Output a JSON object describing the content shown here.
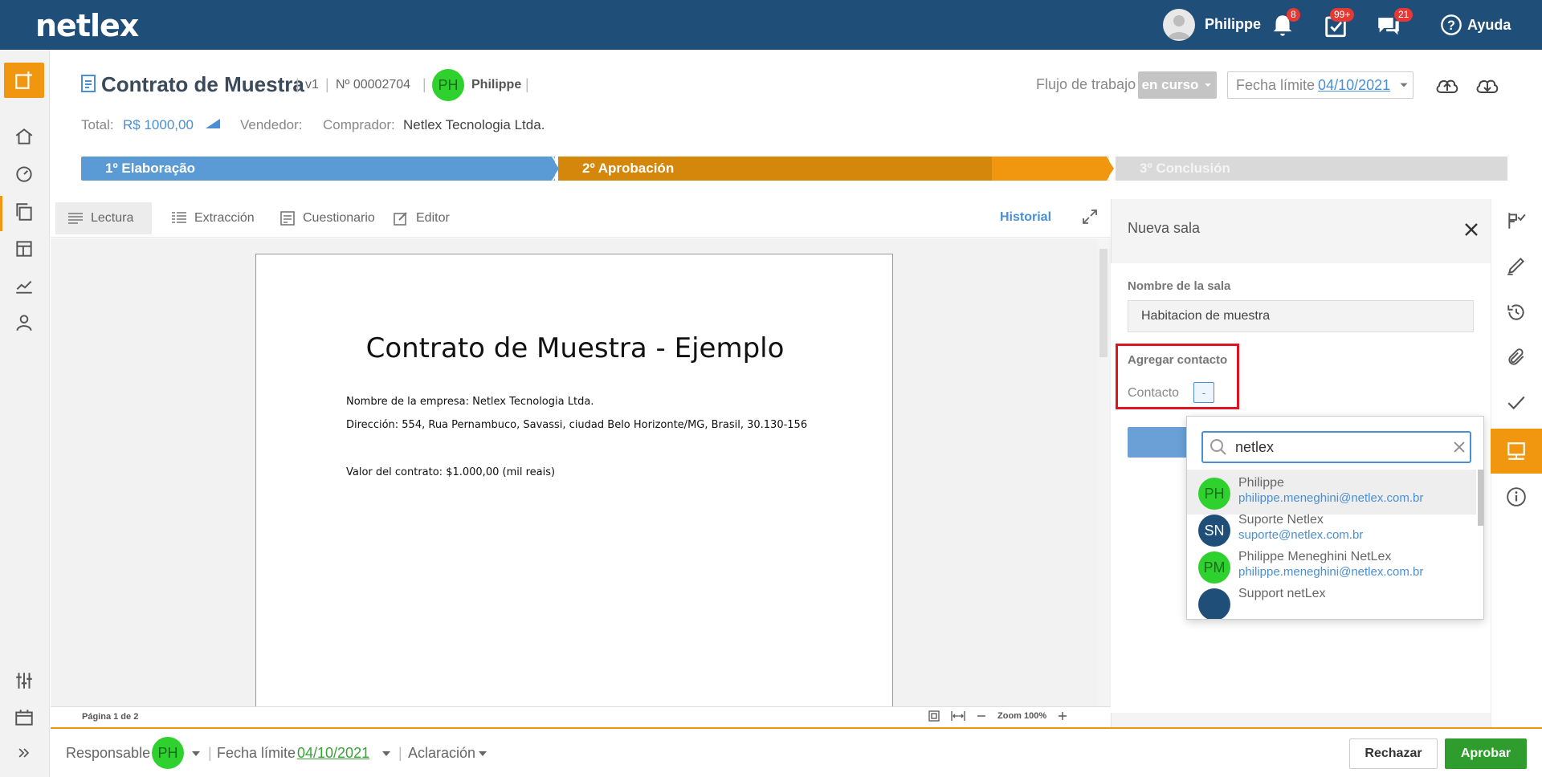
{
  "topbar": {
    "logo": "netlex",
    "user_name": "Philippe",
    "notifications_badge": "8",
    "tasks_badge": "99+",
    "messages_badge": "21",
    "help_label": "Ayuda"
  },
  "document": {
    "title": "Contrato de Muestra",
    "version": "v1",
    "number": "Nº 00002704",
    "owner_initials": "PH",
    "owner_name": "Philippe",
    "workflow_label": "Flujo de trabajo",
    "workflow_status": "en curso",
    "deadline_label": "Fecha límite",
    "deadline_date": "04/10/2021",
    "total_label": "Total:",
    "total_value": "R$ 1000,00",
    "seller_label": "Vendedor:",
    "buyer_label": "Comprador:",
    "buyer_value": "Netlex Tecnologia Ltda."
  },
  "stages": [
    {
      "label": "1º Elaboração",
      "color": "#5b9bd5"
    },
    {
      "label": "2º Aprobación",
      "color": "#f0960f"
    },
    {
      "label": "3º Conclusión",
      "color": "#d9d9d9"
    }
  ],
  "tabs": {
    "reading": "Lectura",
    "extraction": "Extracción",
    "questionnaire": "Cuestionario",
    "editor": "Editor",
    "history": "Historial"
  },
  "page_content": {
    "title": "Contrato de Muestra - Ejemplo",
    "company": "Nombre de la empresa: Netlex Tecnologia Ltda.",
    "address": "Dirección: 554, Rua Pernambuco, Savassi, ciudad Belo Horizonte/MG, Brasil, 30.130-156",
    "value": "Valor del contrato: $1.000,00 (mil reais)"
  },
  "statusbar": {
    "page": "Página 1 de 2",
    "zoom": "Zoom 100%"
  },
  "footer": {
    "responsible_label": "Responsable",
    "responsible_initials": "PH",
    "deadline_label": "Fecha límite",
    "deadline_date": "04/10/2021",
    "clarification_label": "Aclaración",
    "reject_label": "Rechazar",
    "approve_label": "Aprobar"
  },
  "panel": {
    "title": "Nueva sala",
    "room_name_label": "Nombre de la sala",
    "room_name_value": "Habitacion de muestra",
    "add_contact_label": "Agregar contacto",
    "contact_label": "Contacto",
    "contact_button": "-",
    "search_value": "netlex",
    "contacts": [
      {
        "initials": "PH",
        "name": "Philippe",
        "email": "philippe.meneghini@netlex.com.br",
        "avatar_color": "#2ed12e",
        "text_color": "#1a6b1a"
      },
      {
        "initials": "SN",
        "name": "Suporte Netlex",
        "email": "suporte@netlex.com.br",
        "avatar_color": "#1f4e79",
        "text_color": "#ffffff"
      },
      {
        "initials": "PM",
        "name": "Philippe Meneghini NetLex",
        "email": "philippe.meneghini@netlex.com.br",
        "avatar_color": "#2ed12e",
        "text_color": "#1a6b1a"
      },
      {
        "initials": "",
        "name": "Support netLex",
        "email": "",
        "avatar_color": "#1f4e79",
        "text_color": "#ffffff"
      }
    ]
  },
  "colors": {
    "brand_blue": "#1f4e79",
    "accent_orange": "#f0960f",
    "link_blue": "#4a8fd4",
    "approve_green": "#2e9d2e",
    "highlight_red": "#e0141e"
  }
}
